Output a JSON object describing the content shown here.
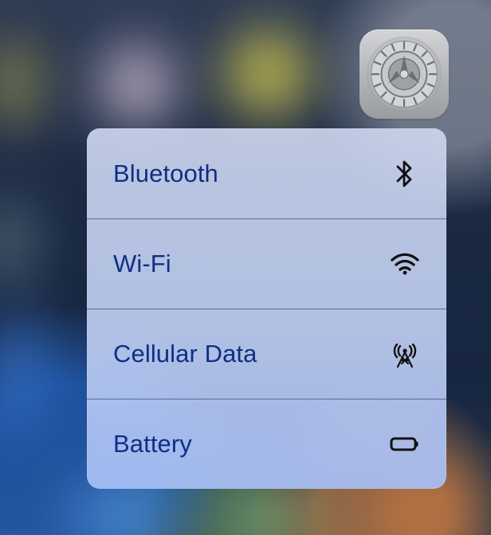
{
  "background": {
    "kind": "blurred-home-screen"
  },
  "settings_app": {
    "icon": "settings-gear-icon"
  },
  "menu": {
    "items": [
      {
        "label": "Bluetooth",
        "icon": "bluetooth-icon"
      },
      {
        "label": "Wi-Fi",
        "icon": "wifi-icon"
      },
      {
        "label": "Cellular Data",
        "icon": "cellular-data-icon"
      },
      {
        "label": "Battery",
        "icon": "battery-icon"
      }
    ]
  },
  "colors": {
    "menu_text": "#0f2f84",
    "menu_bg": "#c5d2f1",
    "settings_gray": "#b6b8bc"
  }
}
